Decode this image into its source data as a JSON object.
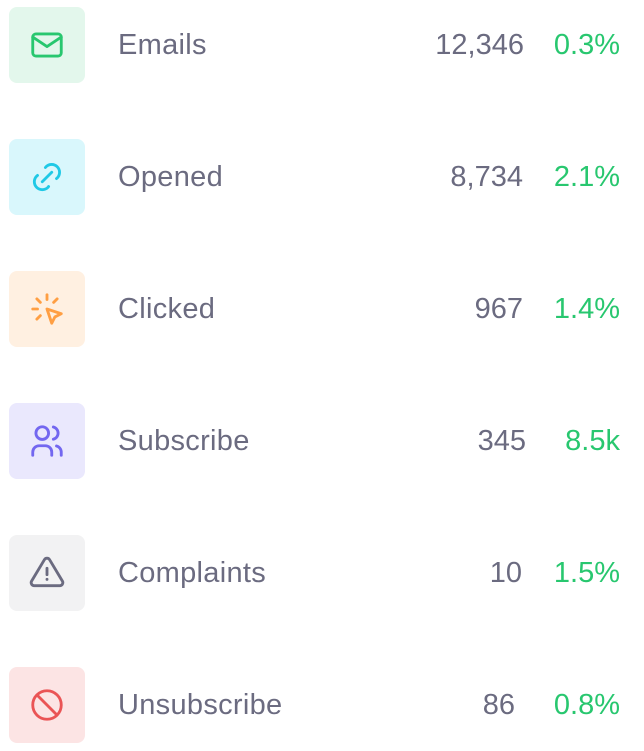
{
  "stats": [
    {
      "label": "Emails",
      "value": "12,346",
      "change": "0.3%",
      "icon": "mail-icon",
      "bg": "#e3f7ec",
      "color": "#28c76f"
    },
    {
      "label": "Opened",
      "value": "8,734",
      "change": "2.1%",
      "icon": "link-icon",
      "bg": "#d9f7fc",
      "color": "#1fc9e6"
    },
    {
      "label": "Clicked",
      "value": "967",
      "change": "1.4%",
      "icon": "pointer-click-icon",
      "bg": "#fff0e1",
      "color": "#ff9f43"
    },
    {
      "label": "Subscribe",
      "value": "345",
      "change": "8.5k",
      "icon": "users-icon",
      "bg": "#eae8fd",
      "color": "#7367f0"
    },
    {
      "label": "Complaints",
      "value": "10",
      "change": "1.5%",
      "icon": "alert-triangle-icon",
      "bg": "#f2f2f3",
      "color": "#6b6b80"
    },
    {
      "label": "Unsubscribe",
      "value": "86",
      "change": "0.8%",
      "icon": "ban-icon",
      "bg": "#fce4e4",
      "color": "#ea5455"
    }
  ]
}
